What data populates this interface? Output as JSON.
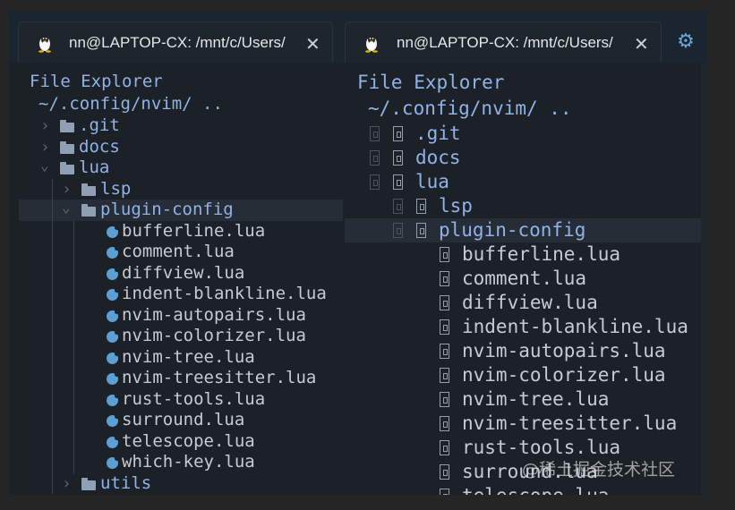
{
  "tabs": [
    {
      "title": "nn@LAPTOP-CX: /mnt/c/Users/",
      "close_label": "✕"
    },
    {
      "title": "nn@LAPTOP-CX: /mnt/c/Users/",
      "close_label": "✕"
    }
  ],
  "settings_icon": "gear-icon",
  "left_pane": {
    "header": "File Explorer",
    "path": "~/.config/nvim/ ..",
    "entries": [
      {
        "name": ".git",
        "type": "dir",
        "expanded": false,
        "depth": 0
      },
      {
        "name": "docs",
        "type": "dir",
        "expanded": false,
        "depth": 0
      },
      {
        "name": "lua",
        "type": "dir",
        "expanded": true,
        "depth": 0
      },
      {
        "name": "lsp",
        "type": "dir",
        "expanded": false,
        "depth": 1
      },
      {
        "name": "plugin-config",
        "type": "dir",
        "expanded": true,
        "depth": 1,
        "highlighted": true
      },
      {
        "name": "bufferline.lua",
        "type": "file",
        "depth": 2
      },
      {
        "name": "comment.lua",
        "type": "file",
        "depth": 2
      },
      {
        "name": "diffview.lua",
        "type": "file",
        "depth": 2
      },
      {
        "name": "indent-blankline.lua",
        "type": "file",
        "depth": 2
      },
      {
        "name": "nvim-autopairs.lua",
        "type": "file",
        "depth": 2
      },
      {
        "name": "nvim-colorizer.lua",
        "type": "file",
        "depth": 2
      },
      {
        "name": "nvim-tree.lua",
        "type": "file",
        "depth": 2
      },
      {
        "name": "nvim-treesitter.lua",
        "type": "file",
        "depth": 2
      },
      {
        "name": "rust-tools.lua",
        "type": "file",
        "depth": 2
      },
      {
        "name": "surround.lua",
        "type": "file",
        "depth": 2
      },
      {
        "name": "telescope.lua",
        "type": "file",
        "depth": 2
      },
      {
        "name": "which-key.lua",
        "type": "file",
        "depth": 2
      },
      {
        "name": "utils",
        "type": "dir",
        "expanded": false,
        "depth": 1
      }
    ]
  },
  "right_pane": {
    "header": "File Explorer",
    "path": "~/.config/nvim/ ..",
    "entries": [
      {
        "name": ".git",
        "type": "dir",
        "depth": 0
      },
      {
        "name": "docs",
        "type": "dir",
        "depth": 0
      },
      {
        "name": "lua",
        "type": "dir",
        "depth": 0
      },
      {
        "name": "lsp",
        "type": "dir",
        "depth": 1
      },
      {
        "name": "plugin-config",
        "type": "dir",
        "depth": 1,
        "highlighted": true
      },
      {
        "name": "bufferline.lua",
        "type": "file",
        "depth": 2
      },
      {
        "name": "comment.lua",
        "type": "file",
        "depth": 2
      },
      {
        "name": "diffview.lua",
        "type": "file",
        "depth": 2
      },
      {
        "name": "indent-blankline.lua",
        "type": "file",
        "depth": 2
      },
      {
        "name": "nvim-autopairs.lua",
        "type": "file",
        "depth": 2
      },
      {
        "name": "nvim-colorizer.lua",
        "type": "file",
        "depth": 2
      },
      {
        "name": "nvim-tree.lua",
        "type": "file",
        "depth": 2
      },
      {
        "name": "nvim-treesitter.lua",
        "type": "file",
        "depth": 2
      },
      {
        "name": "rust-tools.lua",
        "type": "file",
        "depth": 2
      },
      {
        "name": "surround.lua",
        "type": "file",
        "depth": 2
      },
      {
        "name": "telescope.lua",
        "type": "file",
        "depth": 2
      }
    ]
  },
  "watermark": "@稀土掘金技术社区",
  "colors": {
    "dir_text": "#8fb3e8",
    "file_text": "#c5cad3",
    "lua_icon": "#5a9fd6",
    "highlight_row": "#262d36",
    "tab_bar": "#1b2530"
  }
}
